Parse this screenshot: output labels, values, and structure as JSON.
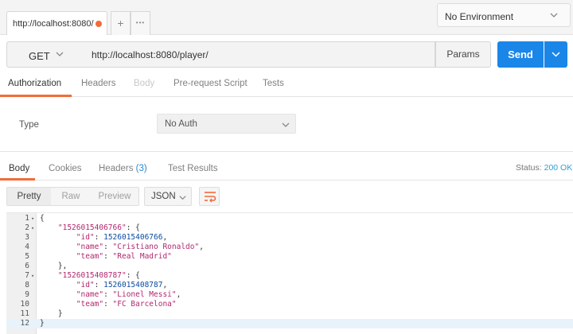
{
  "top_tabs": {
    "request_tab_label": "http://localhost:8080/",
    "add_tab_glyph": "+",
    "more_glyph": "•••",
    "environment": "No Environment"
  },
  "request": {
    "method": "GET",
    "url": "http://localhost:8080/player/",
    "params_label": "Params",
    "send_label": "Send"
  },
  "request_tabs": [
    {
      "label": "Authorization",
      "active": true
    },
    {
      "label": "Headers"
    },
    {
      "label": "Body",
      "disabled": true
    },
    {
      "label": "Pre-request Script"
    },
    {
      "label": "Tests"
    }
  ],
  "auth": {
    "type_label": "Type",
    "type_value": "No Auth"
  },
  "response": {
    "tabs": {
      "body": "Body",
      "cookies": "Cookies",
      "headers": "Headers",
      "headers_count": "(3)",
      "test_results": "Test Results"
    },
    "status_label": "Status:",
    "status_value": "200 OK",
    "view_modes": [
      "Pretty",
      "Raw",
      "Preview"
    ],
    "format": "JSON"
  },
  "code_lines": [
    {
      "n": "1",
      "fold": "▾",
      "text": "{"
    },
    {
      "n": "2",
      "fold": "▾",
      "text": "    \"1526015406766\": {"
    },
    {
      "n": "3",
      "fold": "",
      "text": "        \"id\": 1526015406766,"
    },
    {
      "n": "4",
      "fold": "",
      "text": "        \"name\": \"Cristiano Ronaldo\","
    },
    {
      "n": "5",
      "fold": "",
      "text": "        \"team\": \"Real Madrid\""
    },
    {
      "n": "6",
      "fold": "",
      "text": "    },"
    },
    {
      "n": "7",
      "fold": "▾",
      "text": "    \"1526015408787\": {"
    },
    {
      "n": "8",
      "fold": "",
      "text": "        \"id\": 1526015408787,"
    },
    {
      "n": "9",
      "fold": "",
      "text": "        \"name\": \"Lionel Messi\","
    },
    {
      "n": "10",
      "fold": "",
      "text": "        \"team\": \"FC Barcelona\""
    },
    {
      "n": "11",
      "fold": "",
      "text": "    }"
    },
    {
      "n": "12",
      "fold": "",
      "text": "}"
    }
  ],
  "highlighted_line": "12",
  "colors": {
    "accent_orange": "#f26b3a",
    "send_blue": "#1a86e8",
    "status_blue": "#2aa0d6",
    "json_string": "#b0286d",
    "json_number": "#0d4ba0"
  }
}
